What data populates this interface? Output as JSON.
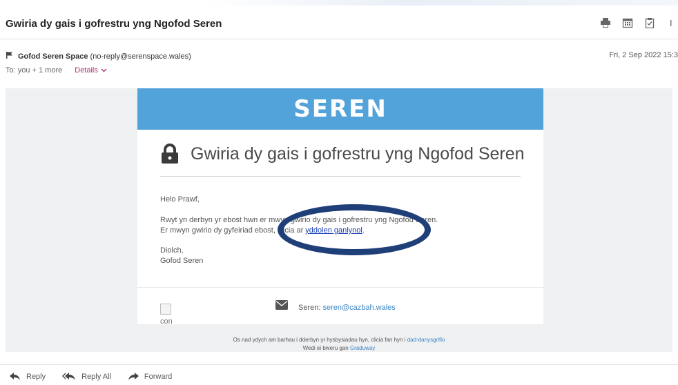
{
  "email": {
    "subject": "Gwiria dy gais i gofrestru yng Ngofod Seren",
    "toolbar": {
      "print_icon": "print-icon",
      "calendar_icon": "calendar-icon",
      "clipboard_icon": "clipboard-icon"
    },
    "sender": {
      "name": "Gofod Seren Space",
      "address": "(no-reply@serenspace.wales)"
    },
    "date": "Fri, 2 Sep 2022 15:3",
    "recipients": "To: you + 1 more",
    "details_label": "Details"
  },
  "message": {
    "brand": "SEREN",
    "brand_color": "#52a3d9",
    "title": "Gwiria dy gais i gofrestru yng Ngofod Seren",
    "greeting": "Helo Prawf,",
    "line1": "Rwyt yn derbyn yr ebost hwn er mwyn gwirio dy gais i gofrestru yng Ngofod Seren.",
    "line2_prefix": "Er mwyn gwirio dy gyfeiriad ebost, clicia ar ",
    "line2_link": "yddolen ganlynol",
    "line2_suffix": ".",
    "signoff": "Diolch,",
    "signature": "Gofod Seren",
    "footer_image_alt": "con",
    "contact_label": "Seren: ",
    "contact_email": "seren@cazbah.wales"
  },
  "footer": {
    "unsubscribe_text": "Os nad ydych am barhau i dderbyn yr hysbysiadau hyn, clicia fan hyn i ",
    "unsubscribe_link": "dad-danysgrifio",
    "powered_text": "Wedi ei bweru gan ",
    "powered_link": "Graduway"
  },
  "actions": {
    "reply": "Reply",
    "reply_all": "Reply All",
    "forward": "Forward"
  }
}
